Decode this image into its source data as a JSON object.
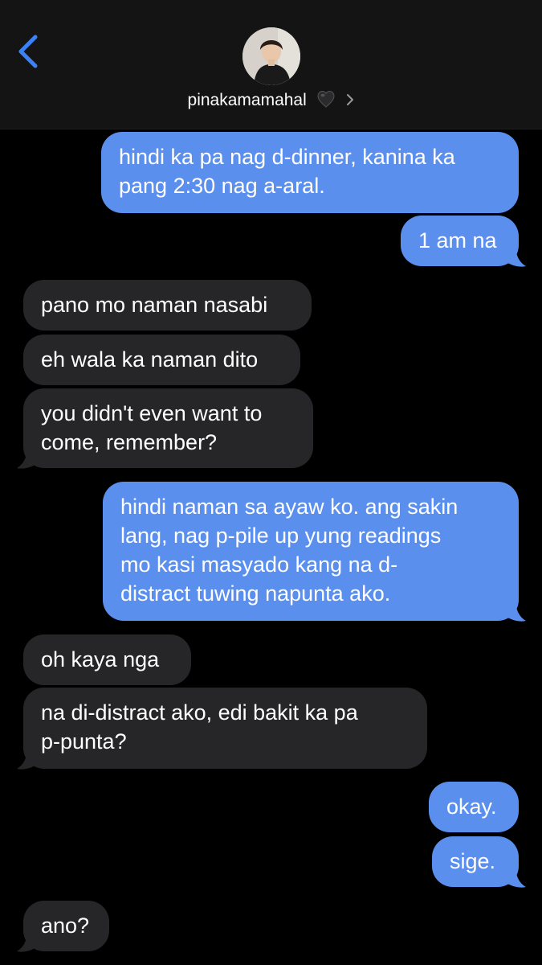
{
  "header": {
    "contact_name": "pinakamamahal",
    "heart_emoji": "🖤",
    "avatar_icon": "contact-photo-avatar",
    "back_icon": "chevron-left-icon",
    "detail_icon": "chevron-right-icon"
  },
  "colors": {
    "sent_bubble": "#5b8fee",
    "received_bubble": "#262628",
    "background": "#000000",
    "header_bg": "#141414",
    "accent": "#3b82f6"
  },
  "messages": [
    {
      "from": "me",
      "lines": [
        "hindi ka pa nag d-dinner, kanina ka",
        "pang 2:30 nag a-aral."
      ]
    },
    {
      "from": "me",
      "lines": [
        "1 am na"
      ]
    },
    {
      "from": "them",
      "lines": [
        "pano mo naman nasabi"
      ]
    },
    {
      "from": "them",
      "lines": [
        "eh wala ka naman dito"
      ]
    },
    {
      "from": "them",
      "lines": [
        "you didn't even want to",
        "come, remember?"
      ]
    },
    {
      "from": "me",
      "lines": [
        "hindi naman sa ayaw ko. ang sakin",
        "lang, nag p-pile up yung readings",
        "mo kasi masyado kang na d-",
        "distract tuwing napunta ako."
      ]
    },
    {
      "from": "them",
      "lines": [
        "oh kaya nga"
      ]
    },
    {
      "from": "them",
      "lines": [
        "na di-distract ako, edi bakit ka pa",
        "p-punta?"
      ]
    },
    {
      "from": "me",
      "lines": [
        "okay."
      ]
    },
    {
      "from": "me",
      "lines": [
        "sige."
      ]
    },
    {
      "from": "them",
      "lines": [
        "ano?"
      ]
    }
  ]
}
